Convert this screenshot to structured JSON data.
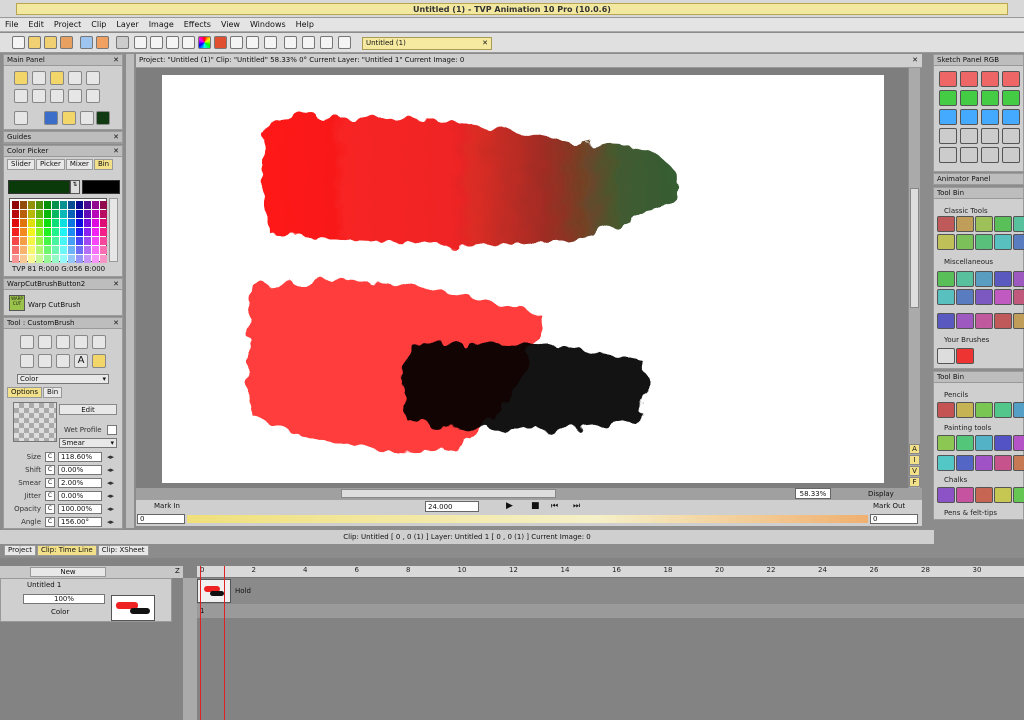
{
  "window": {
    "title": "Untitled (1) - TVP Animation 10 Pro (10.0.6)"
  },
  "menu": [
    "File",
    "Edit",
    "Project",
    "Clip",
    "Layer",
    "Image",
    "Effects",
    "View",
    "Windows",
    "Help"
  ],
  "doc_tab": {
    "label": "Untitled (1)"
  },
  "info_bar": {
    "text": "Project: \"Untitled (1)\"  Clip: \"Untitled\"  58.33%  0°  Current Layer: \"Untitled 1\"  Current Image: 0"
  },
  "left": {
    "main_panel": "Main Panel",
    "guides": "Guides",
    "color_picker": {
      "title": "Color Picker",
      "tabs": [
        "Slider",
        "Picker",
        "Mixer",
        "Bin"
      ],
      "active_tab": "Bin",
      "primary": "#0a3a0a",
      "secondary": "#000000",
      "readout": "TVP 81 R:000 G:056 B:000"
    },
    "warp": {
      "title": "WarpCutBrushButton2",
      "label": "Warp CutBrush",
      "icon_text": "WARP CUT"
    },
    "tool": {
      "title": "Tool : CustomBrush",
      "mode": "Color",
      "tabs": [
        "Options",
        "Bin"
      ],
      "edit": "Edit",
      "wet_profile": "Wet Profile",
      "smear_mode": "Smear",
      "params": [
        {
          "label": "Size",
          "value": "118.60%"
        },
        {
          "label": "Shift",
          "value": "0.00%"
        },
        {
          "label": "Smear",
          "value": "2.00%"
        },
        {
          "label": "Jitter",
          "value": "0.00%"
        },
        {
          "label": "Opacity",
          "value": "100.00%"
        },
        {
          "label": "Angle",
          "value": "156.00°"
        }
      ]
    }
  },
  "transport": {
    "mark_in": "Mark In",
    "mark_out": "Mark Out",
    "in_value": "0",
    "out_value": "0",
    "fps": "24.000",
    "zoom": "58.33%",
    "display": "Display",
    "letters": [
      "A",
      "I",
      "V",
      "F"
    ]
  },
  "status_line": {
    "text": "Clip: Untitled [ 0 , 0  (1) ]     Layer: Untitled 1 [ 0 , 0  (1) ]    Current Image: 0"
  },
  "bottom_tabs": [
    {
      "label": "Project"
    },
    {
      "label": "Clip: Time Line"
    },
    {
      "label": "Clip: XSheet"
    }
  ],
  "timeline": {
    "new_label": "New",
    "z_label": "Z",
    "ticks": [
      "0",
      "2",
      "4",
      "6",
      "8",
      "10",
      "12",
      "14",
      "16",
      "18",
      "20",
      "22",
      "24",
      "26",
      "28",
      "30"
    ],
    "layer_name": "Untitled 1",
    "opacity": "100%",
    "color_label": "Color",
    "hold_label": "Hold",
    "frame_label": "1"
  },
  "right": {
    "sketch_panel": "Sketch Panel RGB",
    "animator_panel": "Animator Panel",
    "tool_bin": "Tool Bin",
    "sections_a": [
      "Classic Tools",
      "Miscellaneous",
      "Your Brushes"
    ],
    "tool_bin2": "Tool Bin",
    "sections_b": [
      "Pencils",
      "Painting tools",
      "Chalks",
      "Pens & felt-tips"
    ]
  }
}
